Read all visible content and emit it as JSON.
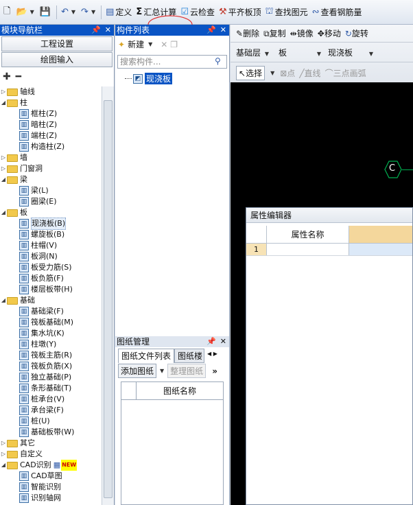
{
  "toolbar": {
    "items": [
      {
        "icon": "new-file-icon",
        "label": ""
      },
      {
        "icon": "open-folder-icon",
        "label": ""
      },
      {
        "icon": "save-icon",
        "label": ""
      },
      {
        "icon": "undo-icon",
        "label": ""
      },
      {
        "icon": "redo-icon",
        "label": ""
      },
      {
        "icon": "define-icon",
        "label": "定义"
      },
      {
        "icon": "sum-icon",
        "label": "汇总计算"
      },
      {
        "icon": "cloud-check-icon",
        "label": "云检查"
      },
      {
        "icon": "level-slab-icon",
        "label": "平齐板顶"
      },
      {
        "icon": "find-icon",
        "label": "查找图元"
      },
      {
        "icon": "rebar-icon",
        "label": "查看钢筋量"
      }
    ]
  },
  "left_nav": {
    "title": "模块导航栏",
    "buttons": [
      "工程设置",
      "绘图输入"
    ],
    "tree": [
      {
        "type": "group",
        "label": "轴线",
        "expanded": false
      },
      {
        "type": "group",
        "label": "柱",
        "expanded": true
      },
      {
        "type": "leaf",
        "label": "框柱(Z)"
      },
      {
        "type": "leaf",
        "label": "暗柱(Z)"
      },
      {
        "type": "leaf",
        "label": "端柱(Z)"
      },
      {
        "type": "leaf",
        "label": "构造柱(Z)"
      },
      {
        "type": "group",
        "label": "墙",
        "expanded": false
      },
      {
        "type": "group",
        "label": "门窗洞",
        "expanded": false
      },
      {
        "type": "group",
        "label": "梁",
        "expanded": true
      },
      {
        "type": "leaf",
        "label": "梁(L)"
      },
      {
        "type": "leaf",
        "label": "圈梁(E)"
      },
      {
        "type": "group",
        "label": "板",
        "expanded": true
      },
      {
        "type": "leaf",
        "label": "现浇板(B)",
        "selected": true
      },
      {
        "type": "leaf",
        "label": "螺旋板(B)"
      },
      {
        "type": "leaf",
        "label": "柱帽(V)"
      },
      {
        "type": "leaf",
        "label": "板洞(N)"
      },
      {
        "type": "leaf",
        "label": "板受力筋(S)"
      },
      {
        "type": "leaf",
        "label": "板负筋(F)"
      },
      {
        "type": "leaf",
        "label": "楼层板带(H)"
      },
      {
        "type": "group",
        "label": "基础",
        "expanded": true
      },
      {
        "type": "leaf",
        "label": "基础梁(F)"
      },
      {
        "type": "leaf",
        "label": "筏板基础(M)"
      },
      {
        "type": "leaf",
        "label": "集水坑(K)"
      },
      {
        "type": "leaf",
        "label": "柱墩(Y)"
      },
      {
        "type": "leaf",
        "label": "筏板主筋(R)"
      },
      {
        "type": "leaf",
        "label": "筏板负筋(X)"
      },
      {
        "type": "leaf",
        "label": "独立基础(P)"
      },
      {
        "type": "leaf",
        "label": "条形基础(T)"
      },
      {
        "type": "leaf",
        "label": "桩承台(V)"
      },
      {
        "type": "leaf",
        "label": "承台梁(F)"
      },
      {
        "type": "leaf",
        "label": "桩(U)"
      },
      {
        "type": "leaf",
        "label": "基础板带(W)"
      },
      {
        "type": "group",
        "label": "其它",
        "expanded": false
      },
      {
        "type": "group",
        "label": "自定义",
        "expanded": false
      },
      {
        "type": "group",
        "label": "CAD识别",
        "expanded": true,
        "badge": "NEW"
      },
      {
        "type": "leaf",
        "label": "CAD草图"
      },
      {
        "type": "leaf",
        "label": "智能识别"
      },
      {
        "type": "leaf",
        "label": "识别轴网"
      }
    ]
  },
  "component_list": {
    "title": "构件列表",
    "new_label": "新建",
    "search_placeholder": "搜索构件...",
    "items": [
      "现浇板"
    ]
  },
  "drawing_mgmt": {
    "title": "图纸管理",
    "tabs": [
      "图纸文件列表",
      "图纸楼"
    ],
    "add_label": "添加图纸",
    "organize_label": "整理图纸",
    "column": "图纸名称"
  },
  "canvas_toolbar": {
    "row1": [
      "删除",
      "复制",
      "镜像",
      "移动",
      "旋转"
    ],
    "floor": "基础层",
    "category": "板",
    "type": "现浇板",
    "row3": [
      "选择",
      "点",
      "直线",
      "三点画弧"
    ]
  },
  "canvas": {
    "axis_label": "C"
  },
  "property_editor": {
    "title": "属性编辑器",
    "col_name": "属性名称",
    "row_num": "1"
  },
  "colors": {
    "panel_header": "#0a54c4",
    "canvas_bg": "#000000",
    "axis": "#00b050"
  }
}
